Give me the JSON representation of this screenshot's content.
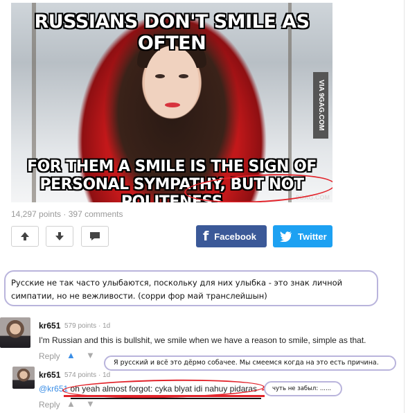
{
  "meme": {
    "caption_top": "RUSSIANS DON'T SMILE AS OFTEN",
    "caption_bottom_line1": "FOR THEM A SMILE IS THE SIGN OF",
    "caption_bottom_line2": "PERSONAL SYMPATHY, BUT NOT POLITENESS",
    "via": "VIA 9GAG.COM",
    "watermark": "9GAG.COM"
  },
  "post": {
    "points": "14,297 points",
    "separator": "·",
    "comments": "397 comments"
  },
  "actions": {
    "upvote_icon": "arrow-up-icon",
    "downvote_icon": "arrow-down-icon",
    "comment_icon": "comment-icon",
    "facebook_label": "Facebook",
    "twitter_label": "Twitter"
  },
  "annotations": {
    "translation_main": "Русские не так часто улыбаются, поскольку для них улыбка - это знак личной симпатии, но не вежливости. (сорри фор май транслейшын)",
    "translation_comment1": "Я русский и всё это дёрмо собачее. Мы смеемся когда на это есть причина.",
    "translation_comment2": "чуть не забыл: ......"
  },
  "comments": [
    {
      "user": "kr651",
      "points": "579 points",
      "time": "1d",
      "text": "I'm Russian and this is bullshit, we smile when we have a reason to smile, simple as that.",
      "reply_label": "Reply"
    },
    {
      "user": "kr651",
      "points": "574 points",
      "time": "1d",
      "mention": "@kr651",
      "text": "oh yeah almost forgot: cyka blyat idi nahuy pidaras",
      "reply_label": "Reply"
    }
  ],
  "colors": {
    "facebook": "#3b5998",
    "twitter": "#1da1f2",
    "annotation_border": "#b9b4dc",
    "highlight_red": "#e2232a",
    "link_blue": "#3b8ee6"
  }
}
